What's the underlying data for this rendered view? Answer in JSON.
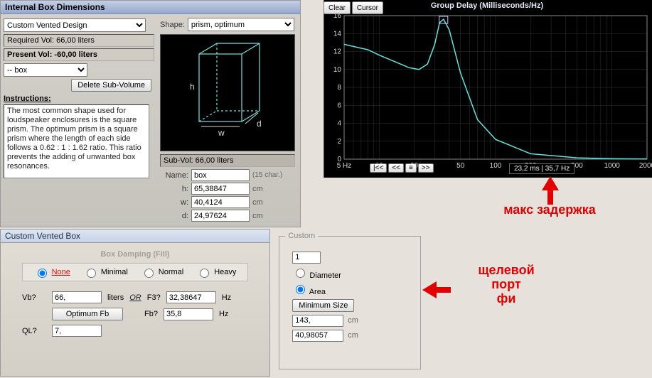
{
  "ibd": {
    "title": "Internal Box Dimensions",
    "design_select": "Custom Vented Design",
    "required_vol": "Required Vol: 66,00 liters",
    "present_vol": "Present Vol: -60,00 liters",
    "box_select": "-- box",
    "delete_btn": "Delete Sub-Volume",
    "instructions_label": "Instructions:",
    "instructions_text": "The most common shape used for loudspeaker enclosures is the square prism. The optimum prism is a square prism where the length of each side follows a 0.62 : 1 : 1.62 ratio. This ratio prevents the adding of unwanted box resonances.",
    "shape_label": "Shape:",
    "shape_select": "prism, optimum",
    "subvol": "Sub-Vol: 66,00 liters",
    "name_label": "Name:",
    "name_val": "box",
    "name_note": "(15 char.)",
    "h_label": "h:",
    "h_val": "65,38847",
    "w_label": "w:",
    "w_val": "40,4124",
    "d_label": "d:",
    "d_val": "24,97624",
    "unit_cm": "cm"
  },
  "cvb": {
    "title": "Custom Vented Box",
    "damp_legend": "Box Damping (Fill)",
    "opts": {
      "none": "None",
      "minimal": "Minimal",
      "normal": "Normal",
      "heavy": "Heavy"
    },
    "vb_label": "Vb?",
    "vb_val": "66,",
    "vb_unit": "liters",
    "or": "OR",
    "f3_label": "F3?",
    "f3_val": "32,38647",
    "hz": "Hz",
    "opt_fb_btn": "Optimum Fb",
    "fb_label": "Fb?",
    "fb_val": "35,8",
    "ql_label": "QL?",
    "ql_val": "7,"
  },
  "custom": {
    "legend": "Custom",
    "count_val": "1",
    "diameter": "Diameter",
    "area": "Area",
    "min_btn": "Minimum Size",
    "v1": "143,",
    "v2": "40,98057",
    "unit": "cm"
  },
  "chart_panel": {
    "clear_btn": "Clear",
    "cursor_btn": "Cursor",
    "title": "Group Delay (Milliseconds/Hz)",
    "readout": "23,2 ms | 35,7 Hz",
    "nav": {
      "first": "|<<",
      "prev": "<<",
      "mode": "≡",
      "next": ">>"
    }
  },
  "annotations": {
    "max_delay": "макс задержка",
    "slot_port": "щелевой\nпорт\nфи"
  },
  "chart_data": {
    "type": "line",
    "title": "Group Delay (Milliseconds/Hz)",
    "xlabel": "Hz",
    "ylabel": "ms",
    "x_scale": "log",
    "xlim": [
      5,
      2000
    ],
    "ylim": [
      0,
      16
    ],
    "y_ticks": [
      0,
      2,
      4,
      6,
      8,
      10,
      12,
      14,
      16
    ],
    "x_ticks": [
      5,
      10,
      20,
      50,
      100,
      200,
      500,
      1000,
      2000
    ],
    "series": [
      {
        "name": "Group Delay",
        "x": [
          5,
          8,
          10,
          14,
          18,
          22,
          26,
          30,
          33,
          35.7,
          40,
          50,
          70,
          100,
          200,
          500,
          1000,
          2000
        ],
        "y": [
          12.8,
          12.2,
          11.6,
          10.8,
          10.2,
          10.0,
          10.6,
          12.8,
          15.2,
          15.6,
          14.4,
          9.6,
          4.4,
          2.2,
          0.6,
          0.15,
          0.05,
          0.02
        ]
      }
    ],
    "cursor": {
      "x": 35.7,
      "y": 23.2,
      "note": "readout shows 23,2 ms at 35,7 Hz (value exceeds visible y-range)"
    }
  }
}
